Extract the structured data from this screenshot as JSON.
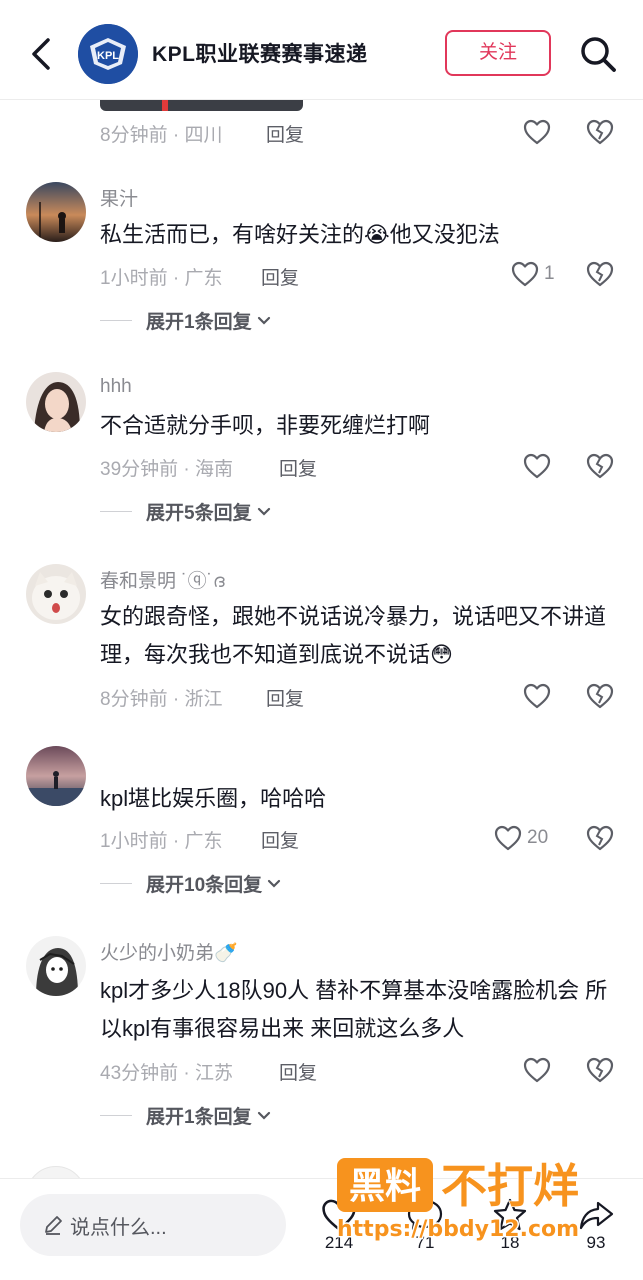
{
  "header": {
    "channel_name": "KPL职业联赛赛事速递",
    "follow_label": "关注",
    "logo_text": "KPL"
  },
  "first_meta": {
    "time_location": "8分钟前 · 四川",
    "reply_label": "回复"
  },
  "comments": [
    {
      "username": "果汁",
      "text": "私生活而已，有啥好关注的😭他又没犯法",
      "time_location": "1小时前 · 广东",
      "reply_label": "回复",
      "likes": "1",
      "expand_label": "展开1条回复"
    },
    {
      "username": "hhh",
      "text": "不合适就分手呗，非要死缠烂打啊",
      "time_location": "39分钟前 · 海南",
      "reply_label": "回复",
      "likes": "",
      "expand_label": "展开5条回复"
    },
    {
      "username": "春和景明 ˙ⓠ˙ദ",
      "text": "女的跟奇怪，跟她不说话说冷暴力，说话吧又不讲道理，每次我也不知道到底说不说话😳",
      "time_location": "8分钟前 · 浙江",
      "reply_label": "回复",
      "likes": "",
      "expand_label": ""
    },
    {
      "username": "",
      "text": "kpl堪比娱乐圈，哈哈哈",
      "time_location": "1小时前 · 广东",
      "reply_label": "回复",
      "likes": "20",
      "expand_label": "展开10条回复"
    },
    {
      "username": "火少的小奶弟🍼",
      "text": "kpl才多少人18队90人 替补不算基本没啥露脸机会 所以kpl有事很容易出来 来回就这么多人",
      "time_location": "43分钟前 · 江苏",
      "reply_label": "回复",
      "likes": "",
      "expand_label": "展开1条回复"
    }
  ],
  "bottom_bar": {
    "input_placeholder": "说点什么...",
    "like_count": "214",
    "comment_count": "71",
    "favorite_count": "18",
    "share_count": "93"
  },
  "watermark": {
    "badge_text": "黑料",
    "tagline": "不打烊",
    "url": "https://bbdy12.com"
  },
  "colors": {
    "accent": "#e1375a",
    "watermark_orange": "#f7931e",
    "muted": "#a9aab0"
  }
}
